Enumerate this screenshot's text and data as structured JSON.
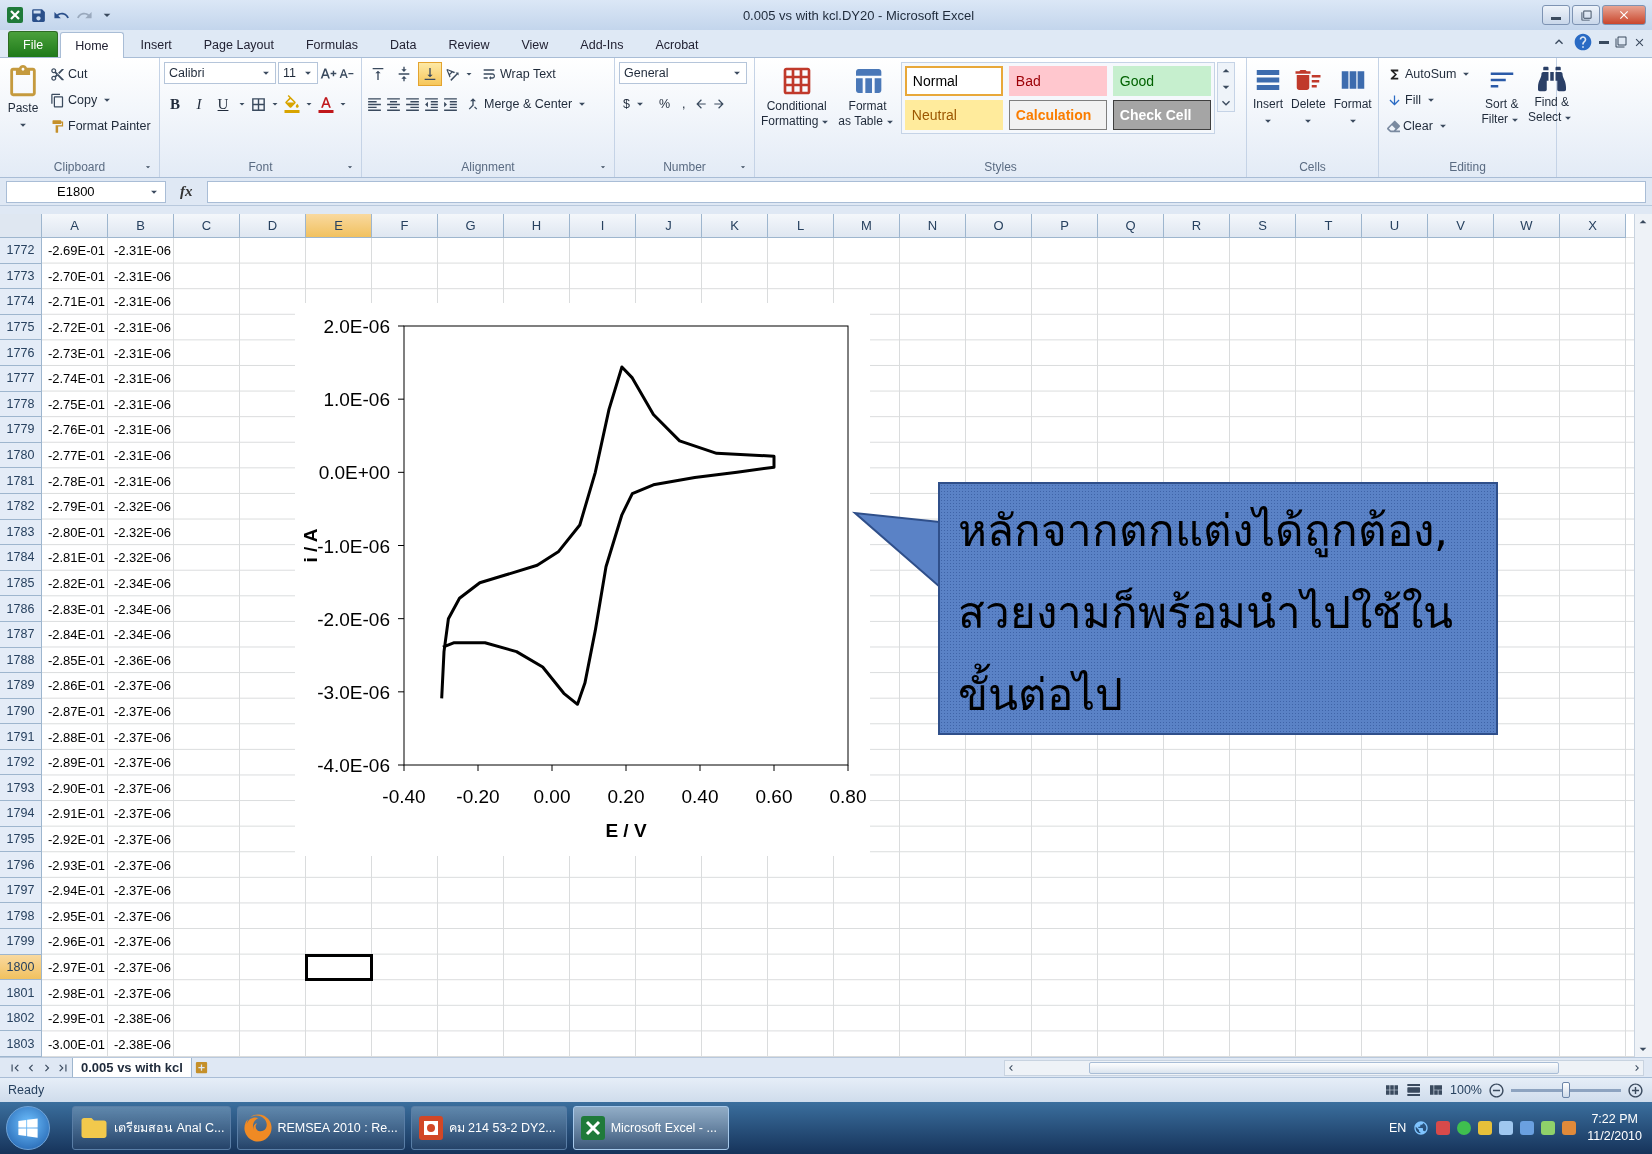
{
  "window": {
    "title": "0.005 vs with kcl.DY20  -  Microsoft Excel"
  },
  "menu_tabs": [
    {
      "label": "File",
      "kind": "file",
      "selected": false
    },
    {
      "label": "Home",
      "kind": "tab",
      "selected": true
    },
    {
      "label": "Insert",
      "kind": "tab",
      "selected": false
    },
    {
      "label": "Page Layout",
      "kind": "tab",
      "selected": false
    },
    {
      "label": "Formulas",
      "kind": "tab",
      "selected": false
    },
    {
      "label": "Data",
      "kind": "tab",
      "selected": false
    },
    {
      "label": "Review",
      "kind": "tab",
      "selected": false
    },
    {
      "label": "View",
      "kind": "tab",
      "selected": false
    },
    {
      "label": "Add-Ins",
      "kind": "tab",
      "selected": false
    },
    {
      "label": "Acrobat",
      "kind": "tab",
      "selected": false
    }
  ],
  "ribbon": {
    "clipboard": {
      "label": "Clipboard",
      "paste": "Paste",
      "cut": "Cut",
      "copy": "Copy",
      "format_painter": "Format Painter"
    },
    "font": {
      "label": "Font",
      "name": "Calibri",
      "size": "11",
      "bold": "B",
      "italic": "I",
      "underline": "U"
    },
    "alignment": {
      "label": "Alignment",
      "vertical_align": [
        {
          "selected": false
        },
        {
          "selected": false
        },
        {
          "selected": true
        }
      ],
      "wrap_text": "Wrap Text",
      "merge": "Merge & Center"
    },
    "number": {
      "label": "Number",
      "format": "General",
      "currency": "$",
      "percent": "%",
      "comma": ","
    },
    "styles": {
      "label": "Styles",
      "conditional_formatting": [
        "Conditional",
        "Formatting"
      ],
      "format_as_table": [
        "Format",
        "as Table"
      ],
      "cell_styles": [
        {
          "label": "Normal",
          "kind": "normal",
          "selected": true
        },
        {
          "label": "Bad",
          "kind": "bad",
          "selected": false
        },
        {
          "label": "Good",
          "kind": "good",
          "selected": false
        },
        {
          "label": "Neutral",
          "kind": "neutral",
          "selected": false
        },
        {
          "label": "Calculation",
          "kind": "calculation",
          "selected": false
        },
        {
          "label": "Check Cell",
          "kind": "check",
          "selected": false
        }
      ]
    },
    "cells": {
      "label": "Cells",
      "buttons": [
        "Insert",
        "Delete",
        "Format"
      ]
    },
    "editing": {
      "label": "Editing",
      "autosum": "AutoSum",
      "fill": "Fill",
      "clear": "Clear",
      "sort_filter": [
        "Sort &",
        "Filter"
      ],
      "find_select": [
        "Find &",
        "Select"
      ]
    }
  },
  "formula_bar": {
    "name_box": "E1800",
    "function_label": "fx"
  },
  "sheet": {
    "columns": [
      {
        "label": "A",
        "selected": false
      },
      {
        "label": "B",
        "selected": false
      },
      {
        "label": "C",
        "selected": false
      },
      {
        "label": "D",
        "selected": false
      },
      {
        "label": "E",
        "selected": true
      },
      {
        "label": "F",
        "selected": false
      },
      {
        "label": "G",
        "selected": false
      },
      {
        "label": "H",
        "selected": false
      },
      {
        "label": "I",
        "selected": false
      },
      {
        "label": "J",
        "selected": false
      },
      {
        "label": "K",
        "selected": false
      },
      {
        "label": "L",
        "selected": false
      },
      {
        "label": "M",
        "selected": false
      },
      {
        "label": "N",
        "selected": false
      },
      {
        "label": "O",
        "selected": false
      },
      {
        "label": "P",
        "selected": false
      },
      {
        "label": "Q",
        "selected": false
      },
      {
        "label": "R",
        "selected": false
      },
      {
        "label": "S",
        "selected": false
      },
      {
        "label": "T",
        "selected": false
      },
      {
        "label": "U",
        "selected": false
      },
      {
        "label": "V",
        "selected": false
      },
      {
        "label": "W",
        "selected": false
      },
      {
        "label": "X",
        "selected": false
      }
    ],
    "rows": [
      {
        "number": "1772",
        "a": "-2.69E-01",
        "b": "-2.31E-06",
        "selected": false
      },
      {
        "number": "1773",
        "a": "-2.70E-01",
        "b": "-2.31E-06",
        "selected": false
      },
      {
        "number": "1774",
        "a": "-2.71E-01",
        "b": "-2.31E-06",
        "selected": false
      },
      {
        "number": "1775",
        "a": "-2.72E-01",
        "b": "-2.31E-06",
        "selected": false
      },
      {
        "number": "1776",
        "a": "-2.73E-01",
        "b": "-2.31E-06",
        "selected": false
      },
      {
        "number": "1777",
        "a": "-2.74E-01",
        "b": "-2.31E-06",
        "selected": false
      },
      {
        "number": "1778",
        "a": "-2.75E-01",
        "b": "-2.31E-06",
        "selected": false
      },
      {
        "number": "1779",
        "a": "-2.76E-01",
        "b": "-2.31E-06",
        "selected": false
      },
      {
        "number": "1780",
        "a": "-2.77E-01",
        "b": "-2.31E-06",
        "selected": false
      },
      {
        "number": "1781",
        "a": "-2.78E-01",
        "b": "-2.31E-06",
        "selected": false
      },
      {
        "number": "1782",
        "a": "-2.79E-01",
        "b": "-2.32E-06",
        "selected": false
      },
      {
        "number": "1783",
        "a": "-2.80E-01",
        "b": "-2.32E-06",
        "selected": false
      },
      {
        "number": "1784",
        "a": "-2.81E-01",
        "b": "-2.32E-06",
        "selected": false
      },
      {
        "number": "1785",
        "a": "-2.82E-01",
        "b": "-2.34E-06",
        "selected": false
      },
      {
        "number": "1786",
        "a": "-2.83E-01",
        "b": "-2.34E-06",
        "selected": false
      },
      {
        "number": "1787",
        "a": "-2.84E-01",
        "b": "-2.34E-06",
        "selected": false
      },
      {
        "number": "1788",
        "a": "-2.85E-01",
        "b": "-2.36E-06",
        "selected": false
      },
      {
        "number": "1789",
        "a": "-2.86E-01",
        "b": "-2.37E-06",
        "selected": false
      },
      {
        "number": "1790",
        "a": "-2.87E-01",
        "b": "-2.37E-06",
        "selected": false
      },
      {
        "number": "1791",
        "a": "-2.88E-01",
        "b": "-2.37E-06",
        "selected": false
      },
      {
        "number": "1792",
        "a": "-2.89E-01",
        "b": "-2.37E-06",
        "selected": false
      },
      {
        "number": "1793",
        "a": "-2.90E-01",
        "b": "-2.37E-06",
        "selected": false
      },
      {
        "number": "1794",
        "a": "-2.91E-01",
        "b": "-2.37E-06",
        "selected": false
      },
      {
        "number": "1795",
        "a": "-2.92E-01",
        "b": "-2.37E-06",
        "selected": false
      },
      {
        "number": "1796",
        "a": "-2.93E-01",
        "b": "-2.37E-06",
        "selected": false
      },
      {
        "number": "1797",
        "a": "-2.94E-01",
        "b": "-2.37E-06",
        "selected": false
      },
      {
        "number": "1798",
        "a": "-2.95E-01",
        "b": "-2.37E-06",
        "selected": false
      },
      {
        "number": "1799",
        "a": "-2.96E-01",
        "b": "-2.37E-06",
        "selected": false
      },
      {
        "number": "1800",
        "a": "-2.97E-01",
        "b": "-2.37E-06",
        "selected": true
      },
      {
        "number": "1801",
        "a": "-2.98E-01",
        "b": "-2.37E-06",
        "selected": false
      },
      {
        "number": "1802",
        "a": "-2.99E-01",
        "b": "-2.38E-06",
        "selected": false
      },
      {
        "number": "1803",
        "a": "-3.00E-01",
        "b": "-2.38E-06",
        "selected": false
      }
    ],
    "chart_data": {
      "type": "line",
      "xlabel": "E / V",
      "ylabel": "i / A",
      "xlim": [
        -0.4,
        0.8
      ],
      "ylim": [
        -4e-06,
        2e-06
      ],
      "xticks": [
        {
          "value": -0.4,
          "label": "-0.40"
        },
        {
          "value": -0.2,
          "label": "-0.20"
        },
        {
          "value": 0,
          "label": "0.00"
        },
        {
          "value": 0.2,
          "label": "0.20"
        },
        {
          "value": 0.4,
          "label": "0.40"
        },
        {
          "value": 0.6,
          "label": "0.60"
        },
        {
          "value": 0.8,
          "label": "0.80"
        }
      ],
      "yticks": [
        {
          "value": 2e-06,
          "label": "2.0E-06"
        },
        {
          "value": 1e-06,
          "label": "1.0E-06"
        },
        {
          "value": 0,
          "label": "0.0E+00"
        },
        {
          "value": -1e-06,
          "label": "-1.0E-06"
        },
        {
          "value": -2e-06,
          "label": "-2.0E-06"
        },
        {
          "value": -3e-06,
          "label": "-3.0E-06"
        },
        {
          "value": -4e-06,
          "label": "-4.0E-06"
        }
      ],
      "x": [
        -0.298,
        -0.292,
        -0.28,
        -0.25,
        -0.195,
        -0.124,
        -0.04,
        0.018,
        0.075,
        0.117,
        0.154,
        0.189,
        0.217,
        0.274,
        0.345,
        0.445,
        0.6,
        0.6,
        0.5,
        0.386,
        0.274,
        0.217,
        0.189,
        0.146,
        0.117,
        0.089,
        0.069,
        0.032,
        -0.025,
        -0.096,
        -0.181,
        -0.266,
        -0.295
      ],
      "series": [
        {
          "color": "#000000",
          "values": [
            -3.09e-06,
            -2.45e-06,
            -2e-06,
            -1.72e-06,
            -1.51e-06,
            -1.4e-06,
            -1.27e-06,
            -1.08e-06,
            -7.2e-07,
            0.0,
            8.6e-07,
            1.44e-06,
            1.29e-06,
            7.9e-07,
            4.3e-07,
            2.6e-07,
            2.2e-07,
            7e-08,
            0.0,
            -7e-08,
            -1.7e-07,
            -2.9e-07,
            -5.8e-07,
            -1.29e-06,
            -2.16e-06,
            -2.88e-06,
            -3.17e-06,
            -3.02e-06,
            -2.66e-06,
            -2.45e-06,
            -2.33e-06,
            -2.33e-06,
            -2.39e-06
          ]
        }
      ]
    }
  },
  "callout": {
    "lines": [
      "หลักจากตกแต่งได้ถูกต้อง,",
      "สวยงามก็พร้อมนำไปใช้ใน",
      "ขั้นต่อไป"
    ]
  },
  "sheet_tabs": [
    {
      "label": "0.005 vs with kcl",
      "selected": true
    }
  ],
  "status_bar": {
    "status": "Ready",
    "zoom": "100%",
    "zoom_level": {
      "level": 0.5
    }
  },
  "taskbar": {
    "items": [
      {
        "label": "เตรียมสอน Anal C...",
        "kind": "folder",
        "selected": false
      },
      {
        "label": "REMSEA 2010 : Re...",
        "kind": "browser",
        "selected": false
      },
      {
        "label": "คม 214 53-2 DY2...",
        "kind": "presentation",
        "selected": false
      },
      {
        "label": "Microsoft Excel - ...",
        "kind": "spreadsheet",
        "selected": true
      }
    ],
    "language": "EN",
    "time": "7:22 PM",
    "date": "11/2/2010"
  }
}
